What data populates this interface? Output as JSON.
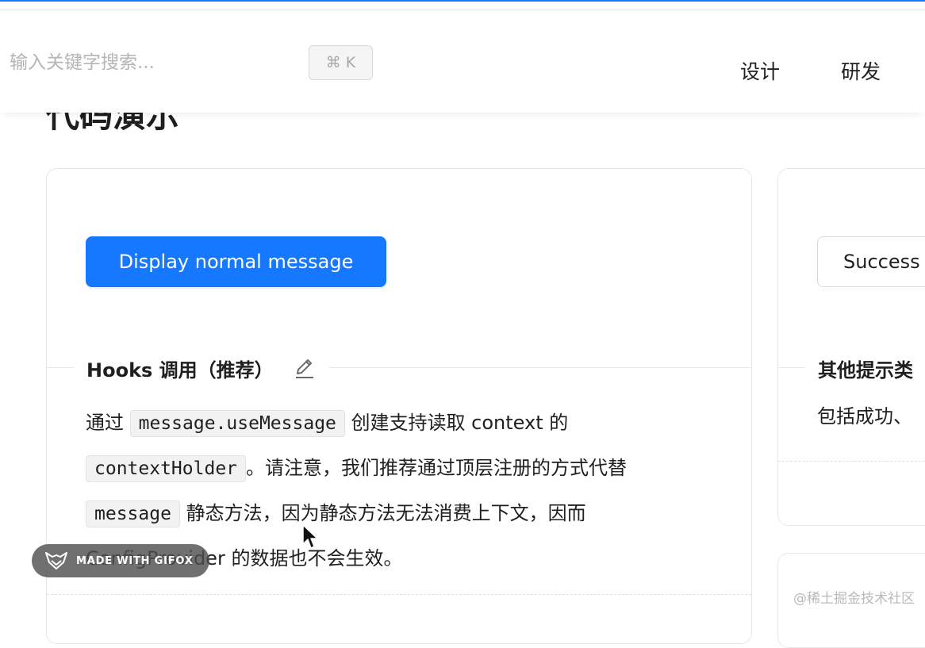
{
  "header": {
    "search": {
      "placeholder": "输入关键字搜索..."
    },
    "shortcut": "⌘ K",
    "nav": {
      "design": "设计",
      "dev": "研发"
    }
  },
  "page": {
    "title": "代码演示"
  },
  "demo_normal": {
    "button": "Display normal message",
    "title": "Hooks 调用（推荐）",
    "desc": {
      "p1": "通过 ",
      "code1": "message.useMessage",
      "p2": " 创建支持读取 context 的 ",
      "code2": "contextHolder",
      "p3": "。请注意，我们推荐通过顶层注册的方式代替 ",
      "code3": "message",
      "p4": " 静态方法，因为静态方法无法消费上下文，因而 ConfigProvider 的数据也不会生效。"
    }
  },
  "demo_types": {
    "button": "Success",
    "title": "其他提示类",
    "desc": "包括成功、"
  },
  "overlay": {
    "gifox": "MADE WITH GIFOX",
    "watermark": "@稀土掘金技术社区"
  },
  "colors": {
    "primary": "#1677ff"
  }
}
